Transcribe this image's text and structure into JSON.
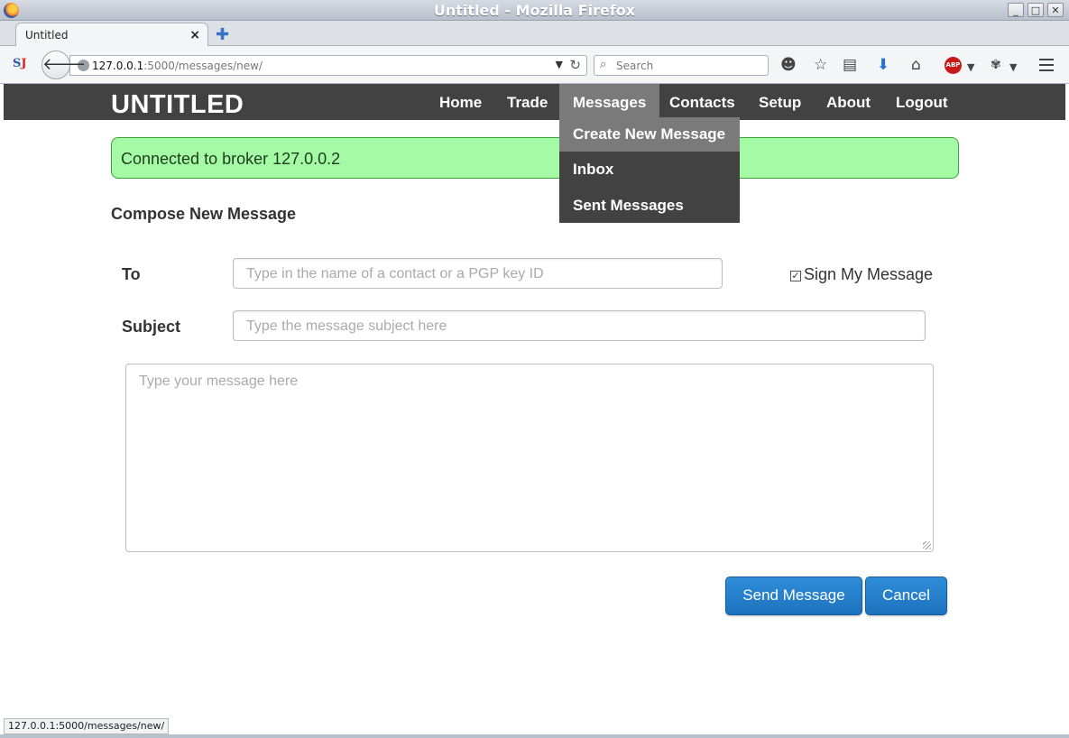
{
  "window": {
    "title": "Untitled - Mozilla Firefox",
    "controls": [
      "_",
      "□",
      "✕"
    ]
  },
  "browser": {
    "tab_label": "Untitled",
    "tab_close": "×",
    "new_tab": "✚",
    "url_host": "127.0.0.1",
    "url_path": ":5000/messages/new/",
    "search_placeholder": "Search",
    "status_url": "127.0.0.1:5000/messages/new/"
  },
  "site": {
    "title": "UNTITLED",
    "nav": [
      "Home",
      "Trade",
      "Messages",
      "Contacts",
      "Setup",
      "About",
      "Logout"
    ],
    "active_nav": "Messages",
    "dropdown": [
      "Create New Message",
      "Inbox",
      "Sent Messages"
    ]
  },
  "alert": {
    "text": "Connected to broker 127.0.0.2",
    "bg_color": "#a5fba5",
    "border_color": "#3aa13a"
  },
  "compose": {
    "heading": "Compose New Message",
    "to_label": "To",
    "to_placeholder": "Type in the name of a contact or a PGP key ID",
    "subject_label": "Subject",
    "subject_placeholder": "Type the message subject here",
    "body_placeholder": "Type your message here",
    "sign_label": "Sign My Message",
    "sign_checked": true,
    "send_label": "Send Message",
    "cancel_label": "Cancel"
  },
  "colors": {
    "header_bg": "#424242",
    "active_nav_bg": "#7a7a7a",
    "button_blue": "#1d72bd"
  },
  "icons": [
    "firefox-logo-icon",
    "s-extension-icon",
    "back-arrow-icon",
    "globe-icon",
    "reload-icon",
    "search-icon",
    "translate-icon",
    "bookmark-star-icon",
    "reading-list-icon",
    "download-icon",
    "home-icon",
    "adblock-icon",
    "mask-addon-icon",
    "hamburger-menu-icon"
  ]
}
